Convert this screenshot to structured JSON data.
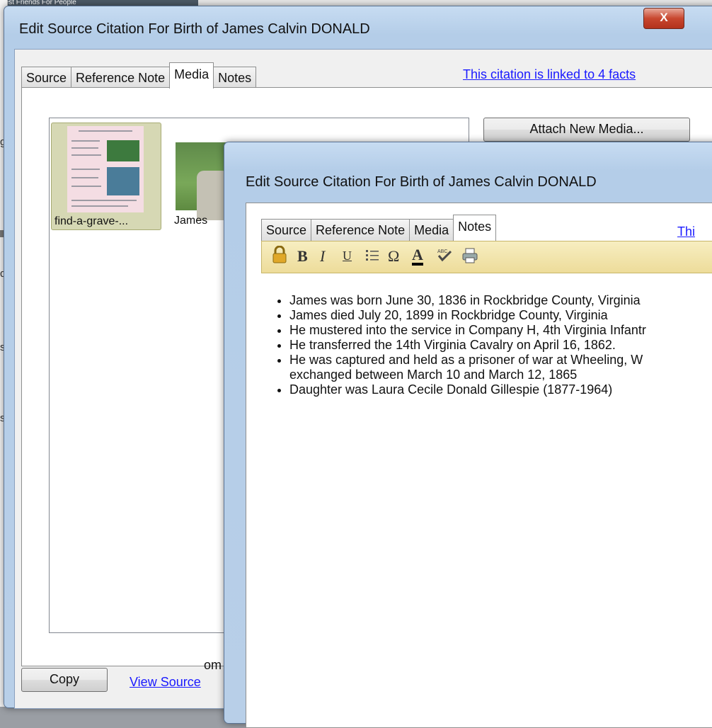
{
  "background": {
    "top_strip_text": "Best Friends For People",
    "left_fragments": [
      "g",
      "di",
      "s",
      "s"
    ]
  },
  "dialog1": {
    "title": "Edit Source Citation For Birth of James Calvin DONALD",
    "close": "X",
    "tabs": [
      "Source",
      "Reference Note",
      "Media",
      "Notes"
    ],
    "active_tab": "Media",
    "citation_link": "This citation is linked to 4 facts",
    "attach_button": "Attach New Media...",
    "media": [
      {
        "caption": "find-a-grave-..."
      },
      {
        "caption": "James"
      }
    ],
    "copy_button": "Copy",
    "view_source_link": "View Source",
    "partial_text": "om"
  },
  "dialog2": {
    "title": "Edit Source Citation For Birth of James Calvin DONALD",
    "tabs": [
      "Source",
      "Reference Note",
      "Media",
      "Notes"
    ],
    "active_tab": "Notes",
    "citation_link": "Thi",
    "toolbar_icons": [
      "lock-icon",
      "bold-icon",
      "italic-icon",
      "underline-icon",
      "bullet-list-icon",
      "omega-icon",
      "font-color-icon",
      "spellcheck-icon",
      "print-icon"
    ],
    "toolbar_glyphs": {
      "bold": "B",
      "italic": "I",
      "underline": "U",
      "omega": "Ω",
      "font_color": "A"
    },
    "notes": [
      "James was born June 30, 1836 in Rockbridge County, Virginia",
      "James died July 20, 1899 in Rockbridge County, Virginia",
      "He mustered into the service in Company H, 4th Virginia Infantr",
      "He transferred the 14th Virginia Cavalry on April 16, 1862.",
      "He was captured and held as a prisoner of war at Wheeling, W",
      "Daughter was Laura Cecile Donald Gillespie (1877-1964)"
    ],
    "note_continuation": "exchanged between March 10 and March 12, 1865"
  },
  "colors": {
    "link": "#1a1aff",
    "toolbar": "#eddc9a",
    "close": "#c8472f",
    "selected_media": "#d6d8b4"
  }
}
